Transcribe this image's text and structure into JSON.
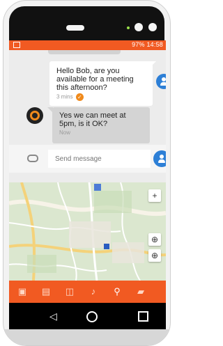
{
  "status_bar": {
    "battery": "97%",
    "time": "14:58"
  },
  "messages": [
    {
      "direction": "outgoing",
      "text": "Hello Bob, are you available for a meeting this afternoon?",
      "time": "3 mins"
    },
    {
      "direction": "incoming",
      "text": "Yes we can meet at 5pm, is it OK?",
      "time": "Now"
    }
  ],
  "composer": {
    "placeholder": "Send message"
  },
  "map_controls": {
    "zoom_in": "+",
    "search_zoom_1": "⊕",
    "search_zoom_2": "⊕"
  },
  "toolbar": [
    {
      "icon": "camera-icon"
    },
    {
      "icon": "image-icon"
    },
    {
      "icon": "sticker-icon"
    },
    {
      "icon": "microphone-icon"
    },
    {
      "icon": "location-icon"
    },
    {
      "icon": "folder-icon"
    }
  ],
  "colors": {
    "accent": "#f15a22",
    "avatar_blue": "#2d7fd6",
    "bubble_incoming": "#d4d4d4",
    "bubble_outgoing": "#ffffff"
  }
}
